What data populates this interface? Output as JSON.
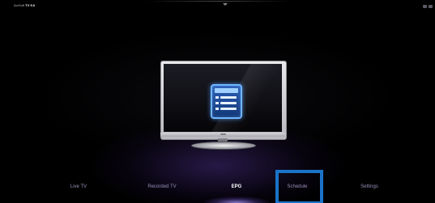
{
  "app": {
    "brand": "ArcSoft",
    "product": "TV 5.0"
  },
  "nav": {
    "items": [
      {
        "id": "live",
        "label": "Live TV",
        "active": false
      },
      {
        "id": "recorded",
        "label": "Recorded TV",
        "active": false
      },
      {
        "id": "epg",
        "label": "EPG",
        "active": true
      },
      {
        "id": "schedule",
        "label": "Schedule",
        "active": false,
        "highlighted": true
      },
      {
        "id": "settings",
        "label": "Settings",
        "active": false
      }
    ]
  },
  "colors": {
    "highlight_box": "#1a73c9",
    "epg_icon": "#2a5fb8",
    "nav_inactive": "#9a8fb8",
    "nav_active": "#ffffff"
  },
  "icons": {
    "center": "epg-list-icon",
    "device": "tv-monitor-icon"
  }
}
